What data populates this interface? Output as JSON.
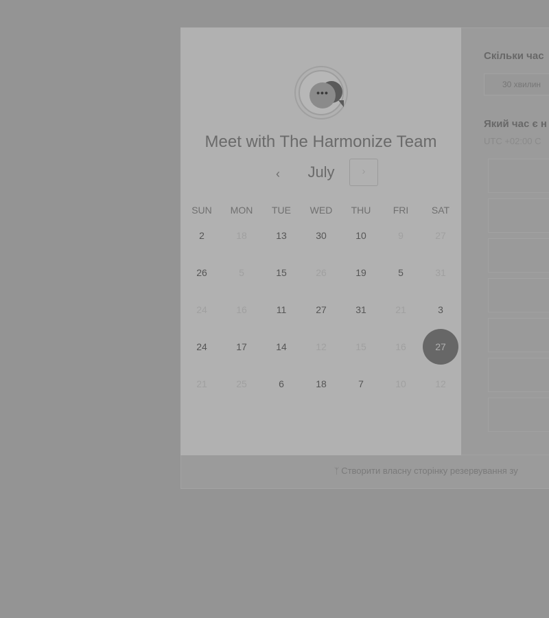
{
  "meeting": {
    "title": "Meet with The Harmonize Team",
    "avatar_icon": "chat-bubble-icon"
  },
  "calendar": {
    "month": "July",
    "prev_icon": "‹",
    "next_icon": "›",
    "weekdays": [
      "SUN",
      "MON",
      "TUE",
      "WED",
      "THU",
      "FRI",
      "SAT"
    ],
    "weeks": [
      [
        {
          "d": "2",
          "a": true
        },
        {
          "d": "18",
          "a": false
        },
        {
          "d": "13",
          "a": true
        },
        {
          "d": "30",
          "a": true
        },
        {
          "d": "10",
          "a": true
        },
        {
          "d": "9",
          "a": false
        },
        {
          "d": "27",
          "a": false
        }
      ],
      [
        {
          "d": "26",
          "a": true
        },
        {
          "d": "5",
          "a": false
        },
        {
          "d": "15",
          "a": true
        },
        {
          "d": "26",
          "a": false
        },
        {
          "d": "19",
          "a": true
        },
        {
          "d": "5",
          "a": true
        },
        {
          "d": "31",
          "a": false
        }
      ],
      [
        {
          "d": "24",
          "a": false
        },
        {
          "d": "16",
          "a": false
        },
        {
          "d": "11",
          "a": true
        },
        {
          "d": "27",
          "a": true
        },
        {
          "d": "31",
          "a": true
        },
        {
          "d": "21",
          "a": false
        },
        {
          "d": "3",
          "a": true
        }
      ],
      [
        {
          "d": "24",
          "a": true
        },
        {
          "d": "17",
          "a": true
        },
        {
          "d": "14",
          "a": true
        },
        {
          "d": "12",
          "a": false
        },
        {
          "d": "15",
          "a": false
        },
        {
          "d": "16",
          "a": false
        },
        {
          "d": "27",
          "a": true,
          "selected": true
        }
      ],
      [
        {
          "d": "21",
          "a": false
        },
        {
          "d": "25",
          "a": false
        },
        {
          "d": "6",
          "a": true
        },
        {
          "d": "18",
          "a": true
        },
        {
          "d": "7",
          "a": true
        },
        {
          "d": "10",
          "a": false
        },
        {
          "d": "12",
          "a": false
        }
      ]
    ]
  },
  "side": {
    "duration_question": "Скільки час",
    "duration_value": "30 хвилин",
    "time_question": "Який час є н",
    "timezone": "UTC +02:00 C",
    "slot_count": 7
  },
  "footer": {
    "sprocket_icon": "ᛉ",
    "link_text": "Створити власну сторінку резервування зу"
  }
}
